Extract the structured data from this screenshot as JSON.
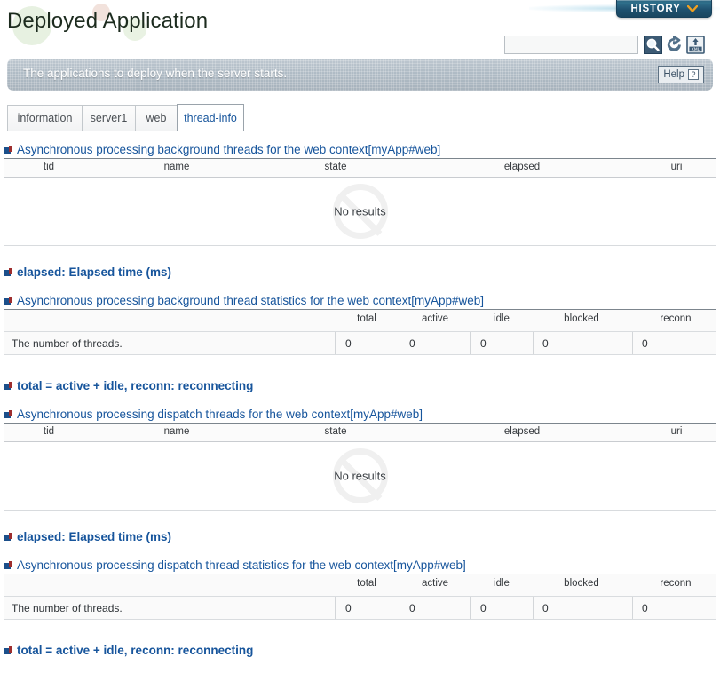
{
  "header": {
    "title": "Deployed Application",
    "history_button": "HISTORY",
    "history_chevron_icon": "chevron-down-icon",
    "history_chevron_color": "#f0a020",
    "search_value": "",
    "search_placeholder": "",
    "search_icon": "magnifier-icon",
    "reload_icon": "reload-icon",
    "xml_export_icon": "xml-export-icon",
    "accent_color": "#17559c",
    "banner_color": "#b0bcc6"
  },
  "banner": {
    "text": "The applications to deploy when the server starts.",
    "help_label": "Help",
    "help_mark": "?"
  },
  "tabs": [
    {
      "label": "information",
      "active": false
    },
    {
      "label": "server1",
      "active": false
    },
    {
      "label": "web",
      "active": false
    },
    {
      "label": "thread-info",
      "active": true
    }
  ],
  "sections": [
    {
      "id": "bg-threads",
      "kind": "thread-list",
      "heading": "Asynchronous processing background threads for the web context[myApp#web]",
      "columns": [
        "tid",
        "name",
        "state",
        "elapsed",
        "uri"
      ],
      "rows": [],
      "empty_text": "No results",
      "empty_icon": "no-entry-icon"
    },
    {
      "id": "bg-note",
      "kind": "note",
      "heading": "elapsed: Elapsed time (ms)"
    },
    {
      "id": "bg-stats",
      "kind": "stats",
      "heading": "Asynchronous processing background thread statistics for the web context[myApp#web]",
      "columns": [
        "total",
        "active",
        "idle",
        "blocked",
        "reconn"
      ],
      "rows": [
        {
          "label": "The number of threads.",
          "values": [
            "0",
            "0",
            "0",
            "0",
            "0"
          ]
        }
      ]
    },
    {
      "id": "bg-legend",
      "kind": "note",
      "heading": "total = active + idle, reconn: reconnecting"
    },
    {
      "id": "dp-threads",
      "kind": "thread-list",
      "heading": "Asynchronous processing dispatch threads for the web context[myApp#web]",
      "columns": [
        "tid",
        "name",
        "state",
        "elapsed",
        "uri"
      ],
      "rows": [],
      "empty_text": "No results",
      "empty_icon": "no-entry-icon"
    },
    {
      "id": "dp-note",
      "kind": "note",
      "heading": "elapsed: Elapsed time (ms)"
    },
    {
      "id": "dp-stats",
      "kind": "stats",
      "heading": "Asynchronous processing dispatch thread statistics for the web context[myApp#web]",
      "columns": [
        "total",
        "active",
        "idle",
        "blocked",
        "reconn"
      ],
      "rows": [
        {
          "label": "The number of threads.",
          "values": [
            "0",
            "0",
            "0",
            "0",
            "0"
          ]
        }
      ]
    },
    {
      "id": "dp-legend",
      "kind": "note",
      "heading": "total = active + idle, reconn: reconnecting"
    }
  ]
}
